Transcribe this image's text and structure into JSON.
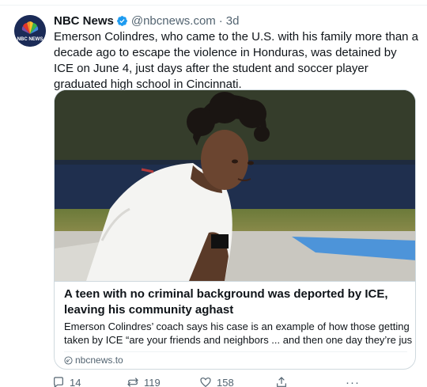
{
  "tweet": {
    "display_name": "NBC News",
    "handle": "@nbcnews.com",
    "separator": "·",
    "time": "3d",
    "avatar_text": "NBC NEWS",
    "text": "Emerson Colindres, who came to the U.S. with his family more than a decade ago to escape the violence in Honduras, was detained by ICE on June 4, just days after the student and soccer player graduated high school in Cincinnati."
  },
  "card": {
    "title": "A teen with no criminal background was deported by ICE, leaving his community aghast",
    "description_line1": "Emerson Colindres’ coach says his case is an example of how those getting",
    "description_line2": "taken by ICE “are your friends and neighbors ... and then one day they’re just ..",
    "domain": "nbcnews.to"
  },
  "actions": {
    "replies": "14",
    "reposts": "119",
    "likes": "158",
    "more": "···"
  },
  "colors": {
    "text": "#0f1419",
    "secondary": "#536471",
    "border": "#cfd9de",
    "verified": "#1d9bf0"
  },
  "icons": [
    "nbc-peacock-icon",
    "verified-icon",
    "link-icon",
    "reply-icon",
    "repost-icon",
    "like-icon",
    "share-icon",
    "more-icon"
  ]
}
